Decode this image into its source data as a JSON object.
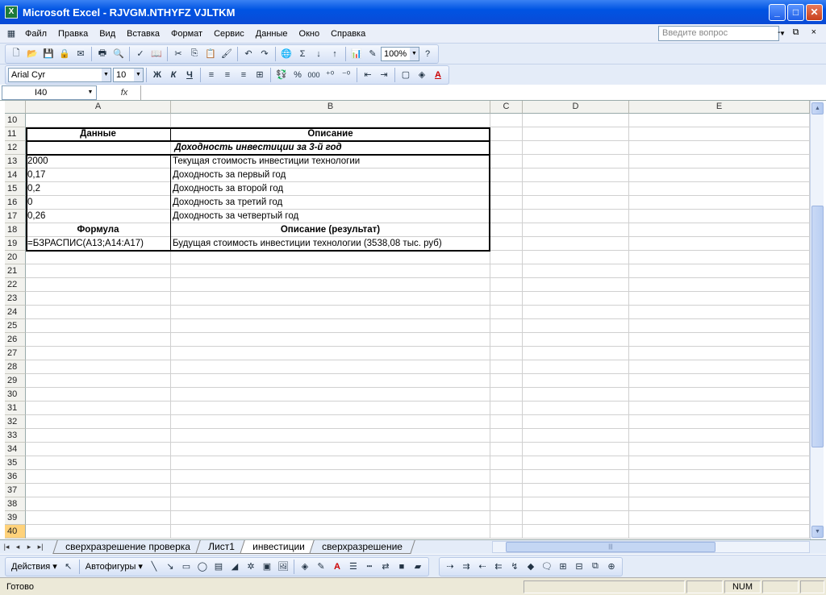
{
  "window": {
    "title": "Microsoft Excel - RJVGM.NTHYFZ VJLTKM",
    "app_icon": "excel-icon",
    "min": "_",
    "max": "□",
    "close": "✕"
  },
  "menu": {
    "items": [
      "Файл",
      "Правка",
      "Вид",
      "Вставка",
      "Формат",
      "Сервис",
      "Данные",
      "Окно",
      "Справка"
    ],
    "ask_placeholder": "Введите вопрос",
    "doc_controls": "- ⧉ ×"
  },
  "toolbar": {
    "zoom": "100%"
  },
  "format_bar": {
    "font": "Arial Cyr",
    "size": "10",
    "bold": "Ж",
    "italic": "К",
    "underline": "Ч",
    "percent": "%",
    "thousands": "000"
  },
  "formula_bar": {
    "cell_ref": "I40",
    "fx": "fx",
    "content": ""
  },
  "columns": [
    "A",
    "B",
    "C",
    "D",
    "E"
  ],
  "rows": [
    "10",
    "11",
    "12",
    "13",
    "14",
    "15",
    "16",
    "17",
    "18",
    "19",
    "20",
    "21",
    "22",
    "23",
    "24",
    "25",
    "26",
    "27",
    "28",
    "29",
    "30",
    "31",
    "32",
    "33",
    "34",
    "35",
    "36",
    "37",
    "38",
    "39",
    "40"
  ],
  "cells": {
    "r11": {
      "a": "Данные",
      "b": "Описание"
    },
    "r12": {
      "a": "Доходность инвестиции  за 3-й год"
    },
    "r13": {
      "a": "2000",
      "b": "Текущая стоимость инвестиции технологии"
    },
    "r14": {
      "a": "0,17",
      "b": "Доходность за первый год"
    },
    "r15": {
      "a": "0,2",
      "b": "Доходность за второй год"
    },
    "r16": {
      "a": "0",
      "b": "Доходность за третий год"
    },
    "r17": {
      "a": "0,26",
      "b": "Доходность за четвертый год"
    },
    "r18": {
      "a": "Формула",
      "b": "Описание (результат)"
    },
    "r19": {
      "a": "=БЗРАСПИС(A13;A14:A17)",
      "b": "Будущая стоимость инвестиции технологии (3538,08 тыс. руб)"
    }
  },
  "sheets": {
    "tabs": [
      "сверхразрешение проверка",
      "Лист1",
      "инвестиции",
      "сверхразрешение"
    ],
    "active": "инвестиции"
  },
  "drawing": {
    "actions": "Действия ▾",
    "autoshapes": "Автофигуры ▾",
    "font_color": "A"
  },
  "status": {
    "text": "Готово",
    "num": "NUM"
  }
}
